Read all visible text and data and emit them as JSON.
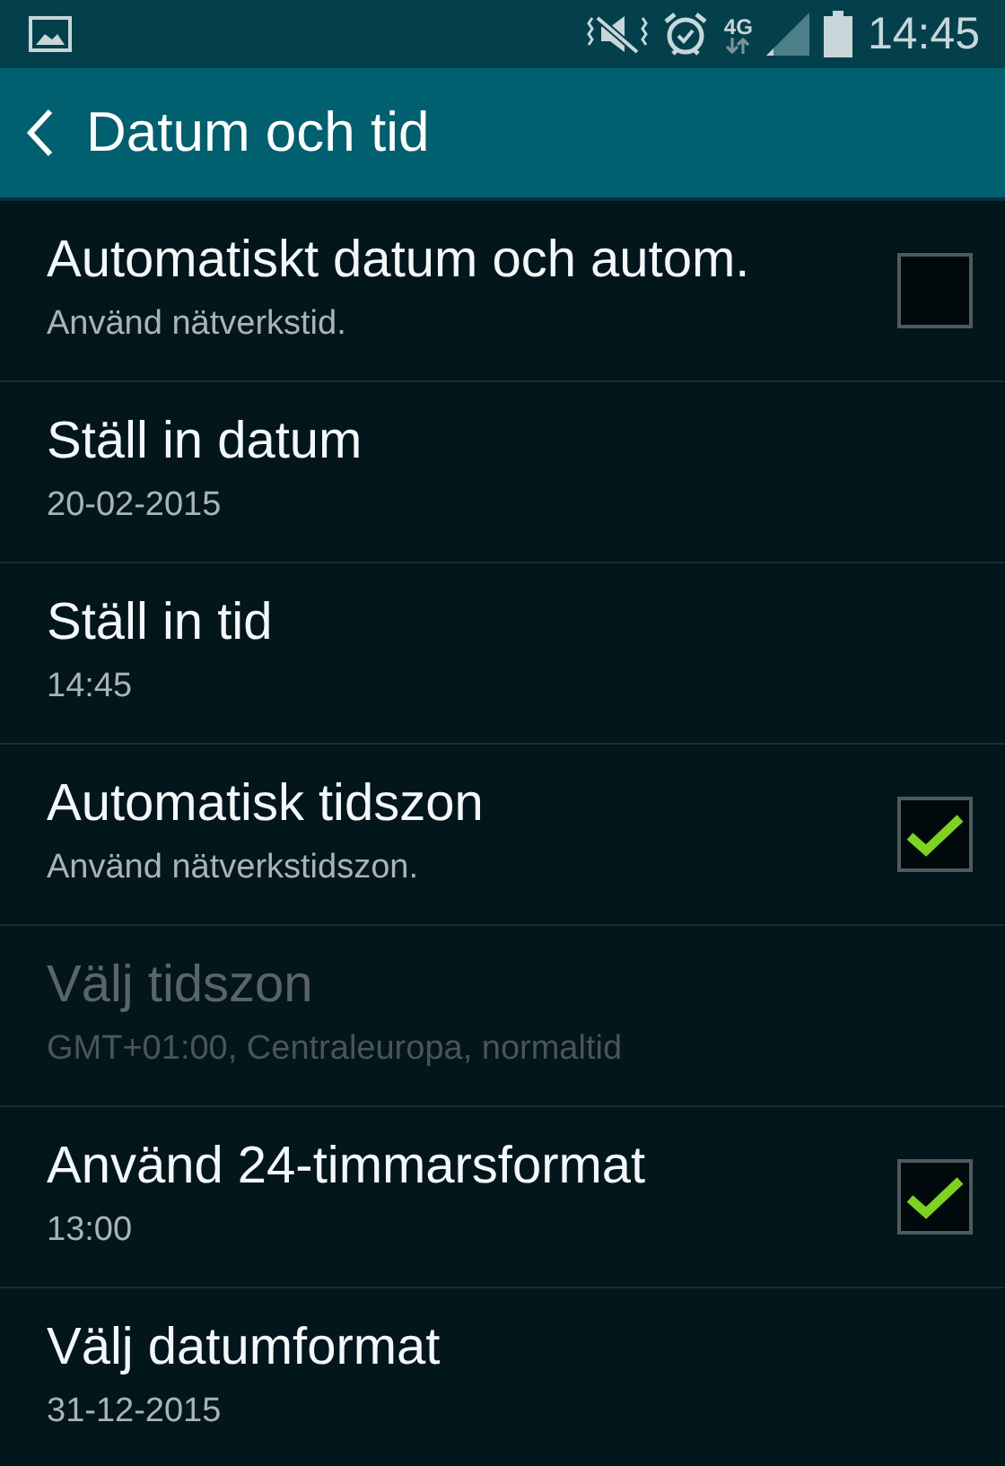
{
  "status_bar": {
    "network": "4G",
    "time": "14:45"
  },
  "app_bar": {
    "title": "Datum och tid"
  },
  "items": [
    {
      "kind": "checkbox",
      "title": "Automatiskt datum och autom.",
      "summary": "Använd nätverkstid.",
      "checked": false,
      "disabled": false
    },
    {
      "kind": "plain",
      "title": "Ställ in datum",
      "summary": "20-02-2015",
      "disabled": false
    },
    {
      "kind": "plain",
      "title": "Ställ in tid",
      "summary": "14:45",
      "disabled": false
    },
    {
      "kind": "checkbox",
      "title": "Automatisk tidszon",
      "summary": "Använd nätverkstidszon.",
      "checked": true,
      "disabled": false
    },
    {
      "kind": "plain",
      "title": "Välj tidszon",
      "summary": "GMT+01:00, Centraleuropa, normaltid",
      "disabled": true
    },
    {
      "kind": "checkbox",
      "title": "Använd 24-timmarsformat",
      "summary": "13:00",
      "checked": true,
      "disabled": false
    },
    {
      "kind": "plain",
      "title": "Välj datumformat",
      "summary": "31-12-2015",
      "disabled": false
    }
  ]
}
